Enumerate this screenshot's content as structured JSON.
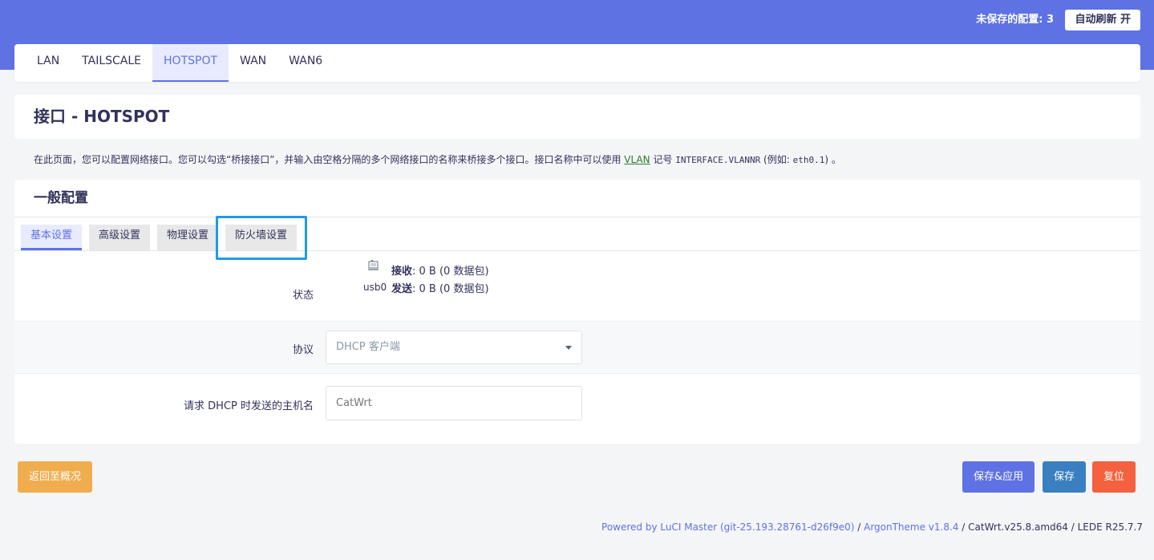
{
  "header": {
    "unsaved_label": "未保存的配置: 3",
    "autorefresh_label": "自动刷新 开"
  },
  "interface_tabs": [
    {
      "label": "LAN",
      "active": false
    },
    {
      "label": "TAILSCALE",
      "active": false
    },
    {
      "label": "HOTSPOT",
      "active": true
    },
    {
      "label": "WAN",
      "active": false
    },
    {
      "label": "WAN6",
      "active": false
    }
  ],
  "page": {
    "title": "接口 - HOTSPOT",
    "description_part1": "在此页面，您可以配置网络接口。您可以勾选“桥接接口”，并输入由空格分隔的多个网络接口的名称来桥接多个接口。接口名称中可以使用 ",
    "description_link": "VLAN",
    "description_part2": " 记号 ",
    "description_code": "INTERFACE.VLANNR",
    "description_part3": " (例如: ",
    "description_code2": "eth0.1",
    "description_part4": ") 。"
  },
  "general": {
    "title": "一般配置",
    "subtabs": [
      {
        "label": "基本设置",
        "active": true
      },
      {
        "label": "高级设置",
        "active": false
      },
      {
        "label": "物理设置",
        "active": false
      },
      {
        "label": "防火墙设置",
        "active": false
      }
    ],
    "status": {
      "label": "状态",
      "device": "usb0",
      "rx_label": "接收",
      "rx_value": ": 0 B (0 数据包)",
      "tx_label": "发送",
      "tx_value": ": 0 B (0 数据包)"
    },
    "protocol": {
      "label": "协议",
      "value": "DHCP 客户端"
    },
    "hostname": {
      "label": "请求 DHCP 时发送的主机名",
      "placeholder": "CatWrt"
    }
  },
  "actions": {
    "back": "返回至概况",
    "save_apply": "保存&应用",
    "save": "保存",
    "reset": "复位"
  },
  "footer": {
    "powered": "Powered by LuCI Master (git-25.193.28761-d26f9e0)",
    "sep1": " / ",
    "theme": "ArgonTheme v1.8.4",
    "rest": " / CatWrt.v25.8.amd64 / LEDE R25.7.7"
  },
  "colors": {
    "primary": "#5e72e4",
    "warning": "#f0ad4e",
    "info": "#3a7fc0",
    "danger": "#f5603f",
    "highlight": "#1e9be8"
  }
}
